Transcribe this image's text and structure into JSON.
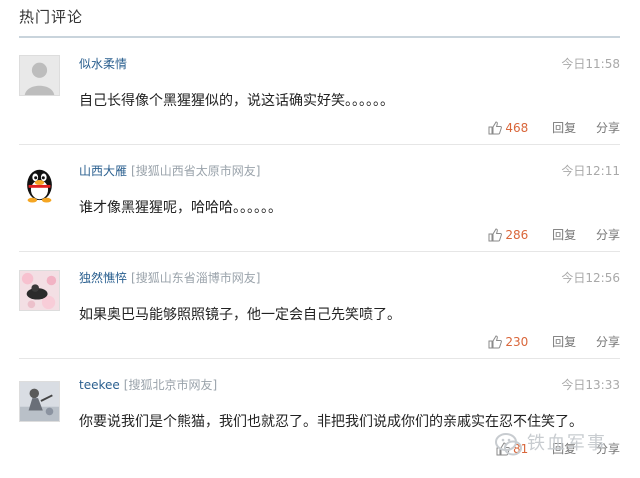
{
  "section": {
    "title": "热门评论"
  },
  "labels": {
    "reply": "回复",
    "share": "分享"
  },
  "comments": [
    {
      "username": "似水柔情",
      "source": "",
      "time": "今日11:58",
      "content": "自己长得像个黑猩猩似的，说这话确实好笑。。。。。。",
      "likes": "468",
      "avatar": "default-silhouette"
    },
    {
      "username": "山西大雁",
      "source": "[搜狐山西省太原市网友]",
      "time": "今日12:11",
      "content": "谁才像黑猩猩呢，哈哈哈。。。。。。",
      "likes": "286",
      "avatar": "qq-penguin"
    },
    {
      "username": "独然憔悴",
      "source": "[搜狐山东省淄博市网友]",
      "time": "今日12:56",
      "content": "如果奥巴马能够照照镜子，他一定会自己先笑喷了。",
      "likes": "230",
      "avatar": "photo-flowers"
    },
    {
      "username": "teekee",
      "source": "[搜狐北京市网友]",
      "time": "今日13:33",
      "content": "你要说我们是个熊猫，我们也就忍了。非把我们说成你们的亲戚实在忍不住笑了。",
      "likes": "81",
      "avatar": "photo-person"
    }
  ],
  "watermark": {
    "text": "铁血军事"
  },
  "colors": {
    "username": "#2a5f8f",
    "likes": "#d9663a",
    "rule": "#c9d4dc"
  }
}
